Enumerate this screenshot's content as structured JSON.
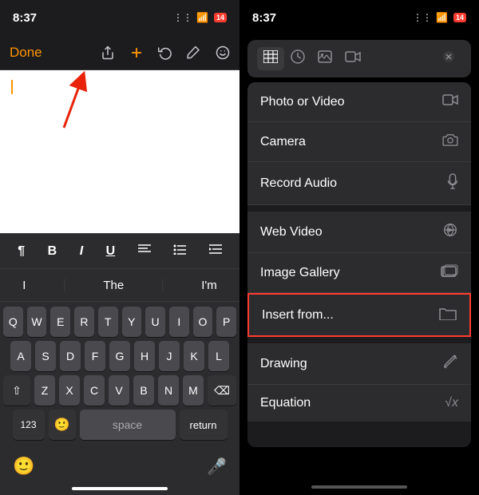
{
  "leftPanel": {
    "statusBar": {
      "time": "8:37",
      "batteryBadge": "14"
    },
    "toolbar": {
      "doneLabel": "Done",
      "icons": [
        "share",
        "plus",
        "undo",
        "markup",
        "emoji"
      ]
    },
    "formatBar": {
      "items": [
        "¶",
        "B",
        "I",
        "U",
        "align-left",
        "list",
        "outdent"
      ]
    },
    "suggestions": [
      "I",
      "The",
      "I'm"
    ],
    "keyboard": {
      "row1": [
        "Q",
        "W",
        "E",
        "R",
        "T",
        "Y",
        "U",
        "I",
        "O",
        "P"
      ],
      "row2": [
        "A",
        "S",
        "D",
        "F",
        "G",
        "H",
        "J",
        "K",
        "L"
      ],
      "row3": [
        "Z",
        "X",
        "C",
        "V",
        "B",
        "N",
        "M"
      ],
      "row4": [
        "123",
        "space",
        "return"
      ]
    }
  },
  "rightPanel": {
    "statusBar": {
      "time": "8:37",
      "batteryBadge": "14"
    },
    "tabs": [
      "table",
      "clock",
      "image",
      "video",
      "close"
    ],
    "menuItems": [
      {
        "label": "Photo or Video",
        "icon": "photo"
      },
      {
        "label": "Camera",
        "icon": "camera"
      },
      {
        "label": "Record Audio",
        "icon": "mic"
      },
      {
        "label": "Web Video",
        "icon": "cloud"
      },
      {
        "label": "Image Gallery",
        "icon": "gallery"
      },
      {
        "label": "Insert from...",
        "icon": "folder",
        "highlighted": true
      },
      {
        "label": "Drawing",
        "icon": "pencil"
      },
      {
        "label": "Equation",
        "icon": "sqrt"
      }
    ]
  }
}
